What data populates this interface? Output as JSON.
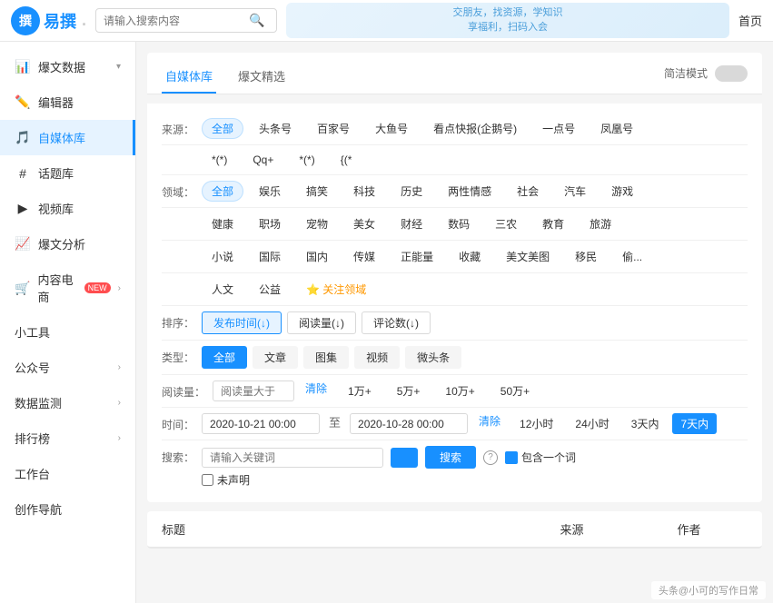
{
  "topbar": {
    "logo_text": "易撰",
    "logo_icon": "撰",
    "search_placeholder": "请输入搜索内容",
    "banner_line1": "交朋友，找资源，学知识",
    "banner_line2": "享福利，扫码入会",
    "nav_home": "首页"
  },
  "sidebar": {
    "items": [
      {
        "id": "爆文数据",
        "label": "爆文数据",
        "icon": "📊",
        "has_arrow": true
      },
      {
        "id": "编辑器",
        "label": "编辑器",
        "icon": "✏️",
        "has_arrow": false
      },
      {
        "id": "自媒体库",
        "label": "自媒体库",
        "icon": "🎵",
        "has_arrow": false,
        "active": true
      },
      {
        "id": "话题库",
        "label": "话题库",
        "icon": "#",
        "has_arrow": false
      },
      {
        "id": "视频库",
        "label": "视频库",
        "icon": "▶",
        "has_arrow": false
      },
      {
        "id": "爆文分析",
        "label": "爆文分析",
        "icon": "📈",
        "has_arrow": false
      },
      {
        "id": "内容电商",
        "label": "内容电商",
        "icon": "🛒",
        "has_arrow": true,
        "badge": "NEW"
      },
      {
        "id": "小工具",
        "label": "小工具",
        "icon": "",
        "has_arrow": false
      },
      {
        "id": "公众号",
        "label": "公众号",
        "icon": "",
        "has_arrow": true
      },
      {
        "id": "数据监测",
        "label": "数据监测",
        "icon": "",
        "has_arrow": true
      },
      {
        "id": "排行榜",
        "label": "排行榜",
        "icon": "",
        "has_arrow": true
      },
      {
        "id": "工作台",
        "label": "工作台",
        "icon": "",
        "has_arrow": false
      },
      {
        "id": "创作导航",
        "label": "创作导航",
        "icon": "",
        "has_arrow": false
      }
    ]
  },
  "tabs": [
    {
      "id": "自媒体库",
      "label": "自媒体库",
      "active": true
    },
    {
      "id": "爆文精选",
      "label": "爆文精选",
      "active": false
    }
  ],
  "simple_mode": "简洁模式",
  "filters": {
    "source_label": "来源：",
    "source_options": [
      {
        "label": "全部",
        "active": true
      },
      {
        "label": "头条号",
        "active": false
      },
      {
        "label": "百家号",
        "active": false
      },
      {
        "label": "大鱼号",
        "active": false
      },
      {
        "label": "看点快报(企鹅号)",
        "active": false
      },
      {
        "label": "一点号",
        "active": false
      },
      {
        "label": "凤凰号",
        "active": false
      }
    ],
    "source_row2": [
      {
        "label": "*(*)"
      },
      {
        "label": "Qq+"
      },
      {
        "label": "*(*)"
      },
      {
        "label": "{(*"
      }
    ],
    "domain_label": "领域：",
    "domain_options": [
      {
        "label": "全部",
        "active": true
      },
      {
        "label": "娱乐"
      },
      {
        "label": "搞笑"
      },
      {
        "label": "科技"
      },
      {
        "label": "历史"
      },
      {
        "label": "两性情感"
      },
      {
        "label": "社会"
      },
      {
        "label": "汽车"
      },
      {
        "label": "游戏"
      },
      {
        "label": "健康"
      },
      {
        "label": "职场"
      },
      {
        "label": "宠物"
      },
      {
        "label": "美女"
      },
      {
        "label": "财经"
      },
      {
        "label": "数码"
      },
      {
        "label": "三农"
      },
      {
        "label": "教育"
      },
      {
        "label": "旅游"
      },
      {
        "label": "小说"
      },
      {
        "label": "国际"
      },
      {
        "label": "国内"
      },
      {
        "label": "传媒"
      },
      {
        "label": "正能量"
      },
      {
        "label": "收藏"
      },
      {
        "label": "美文美图"
      },
      {
        "label": "移民"
      },
      {
        "label": "偷..."
      },
      {
        "label": "人文"
      },
      {
        "label": "公益"
      },
      {
        "label": "⭐ 关注领域",
        "special": true
      }
    ],
    "sort_label": "排序：",
    "sort_options": [
      {
        "label": "发布时间(↓)",
        "active": true
      },
      {
        "label": "阅读量(↓)",
        "active": false
      },
      {
        "label": "评论数(↓)",
        "active": false
      }
    ],
    "type_label": "类型：",
    "type_options": [
      {
        "label": "全部",
        "active": true
      },
      {
        "label": "文章"
      },
      {
        "label": "图集"
      },
      {
        "label": "视频"
      },
      {
        "label": "微头条"
      }
    ],
    "read_label": "阅读量：",
    "read_placeholder": "阅读量大于",
    "read_clear": "清除",
    "read_options": [
      "1万+",
      "5万+",
      "10万+",
      "50万+"
    ],
    "time_label": "时间：",
    "time_start": "2020-10-21 00:00",
    "time_to": "至",
    "time_end": "2020-10-28 00:00",
    "time_clear": "清除",
    "time_quick": [
      "12小时",
      "24小时",
      "3天内",
      "7天内"
    ],
    "time_active": "7天内",
    "search_label": "搜索：",
    "search_placeholder": "请输入关键词",
    "search_btn": "搜索",
    "include_one": "包含一个词",
    "no_declare": "未声明"
  },
  "table": {
    "col_title": "标题",
    "col_source": "来源",
    "col_author": "作者"
  },
  "bottom_watermark": "头条@小可的写作日常"
}
